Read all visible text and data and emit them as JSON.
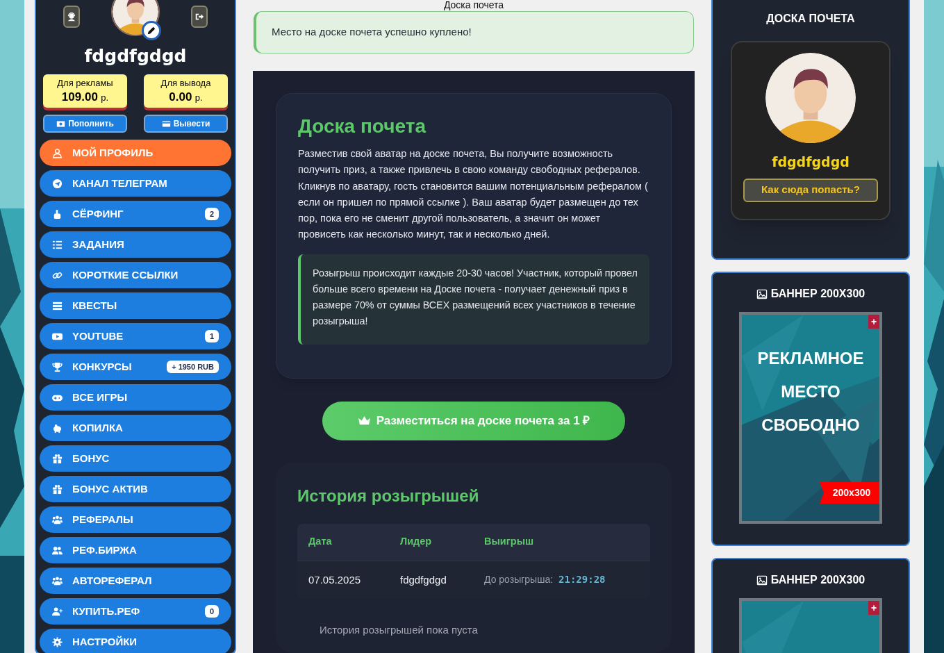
{
  "page_title": "Доска почета",
  "alert": "Место на доске почета успешно куплено!",
  "sidebar": {
    "username": "fdgdfgdgd",
    "balances": [
      {
        "label": "Для рекламы",
        "amount": "109.00",
        "unit": "р."
      },
      {
        "label": "Для вывода",
        "amount": "0.00",
        "unit": "р."
      }
    ],
    "actions": [
      "Пополнить",
      "Вывести"
    ],
    "items": [
      {
        "label": "МОЙ ПРОФИЛЬ",
        "selected": true
      },
      {
        "label": "КАНАЛ ТЕЛЕГРАМ",
        "selected": false
      },
      {
        "label": "СЁРФИНГ",
        "selected": false,
        "badge": "2"
      },
      {
        "label": "ЗАДАНИЯ",
        "selected": false
      },
      {
        "label": "КОРОТКИЕ ССЫЛКИ",
        "selected": false
      },
      {
        "label": "КВЕСТЫ",
        "selected": false
      },
      {
        "label": "YOUTUBE",
        "selected": false,
        "badge": "1"
      },
      {
        "label": "КОНКУРСЫ",
        "selected": false,
        "badge": "+ 1950 RUB"
      },
      {
        "label": "ВСЕ ИГРЫ",
        "selected": false
      },
      {
        "label": "КОПИЛКА",
        "selected": false
      },
      {
        "label": "БОНУС",
        "selected": false
      },
      {
        "label": "БОНУС АКТИВ",
        "selected": false
      },
      {
        "label": "РЕФЕРАЛЫ",
        "selected": false
      },
      {
        "label": "РЕФ.БИРЖА",
        "selected": false
      },
      {
        "label": "АВТОРЕФЕРАЛ",
        "selected": false
      },
      {
        "label": "КУПИТЬ.РЕФ",
        "selected": false,
        "badge": "0"
      },
      {
        "label": "НАСТРОЙКИ",
        "selected": false
      }
    ]
  },
  "honor_board": {
    "title": "Доска почета",
    "description": "Разместив свой аватар на доске почета, Вы получите возможность получить приз, а также привлечь в свою команду свободных рефералов. Кликнув по аватару, гость становится вашим потенциальным рефералом ( если он пришел по прямой ссылке ). Ваш аватар будет размещен до тех пор, пока его не сменит другой пользователь, а значит он может провисеть как несколько минут, так и несколько дней.",
    "note": "Розыгрыш происходит каждые 20-30 часов! Участник, который провел больше всего времени на Доске почета - получает денежный приз в размере 70% от суммы ВСЕХ размещений всех участников в течение розыгрыша!",
    "button": "Разместиться на доске почета за 1 ₽"
  },
  "history": {
    "title": "История розыгрышей",
    "columns": [
      "Дата",
      "Лидер",
      "Выигрыш"
    ],
    "rows": [
      {
        "date": "07.05.2025",
        "leader": "fdgdfgdgd",
        "prize_label": "До розыгрыша:",
        "timer": "21:29:28"
      }
    ],
    "empty_message": "История розыгрышей пока пуста"
  },
  "right": {
    "honor_card": {
      "title": "ДОСКА ПОЧЕТА",
      "name": "fdgdfgdgd",
      "button": "Как сюда попасть?"
    },
    "banners": [
      {
        "title": "БАННЕР 200X300",
        "add_mark": "+",
        "lines": [
          "РЕКЛАМНОЕ",
          "МЕСТО",
          "СВОБОДНО"
        ],
        "size_tag": "200x300"
      },
      {
        "title": "БАННЕР 200X300",
        "add_mark": "+"
      }
    ]
  }
}
